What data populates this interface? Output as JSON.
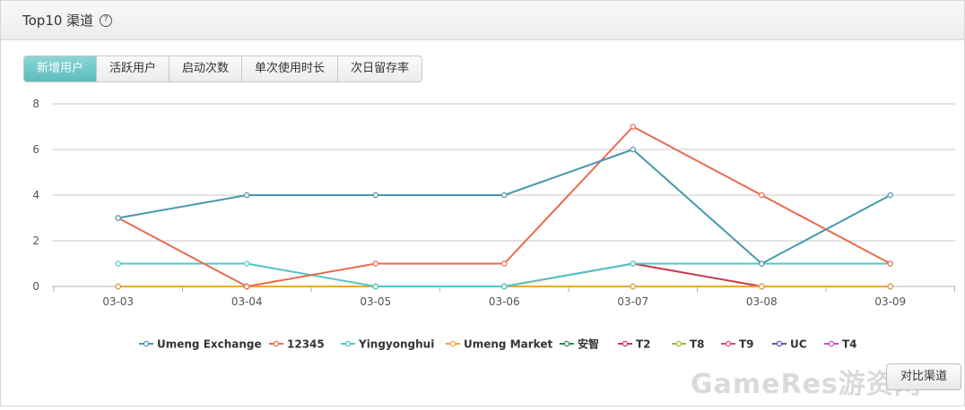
{
  "header": {
    "title": "Top10 渠道",
    "help_icon": "?"
  },
  "tabs": [
    {
      "label": "新增用户",
      "active": true
    },
    {
      "label": "活跃用户",
      "active": false
    },
    {
      "label": "启动次数",
      "active": false
    },
    {
      "label": "单次使用时长",
      "active": false
    },
    {
      "label": "次日留存率",
      "active": false
    }
  ],
  "compare_button": "对比渠道",
  "watermark": "GameRes游资网",
  "chart_data": {
    "type": "line",
    "categories": [
      "03-03",
      "03-04",
      "03-05",
      "03-06",
      "03-07",
      "03-08",
      "03-09"
    ],
    "ylim": [
      0,
      8
    ],
    "yticks": [
      0,
      2,
      4,
      6,
      8
    ],
    "grid": true,
    "legend_position": "bottom",
    "series": [
      {
        "name": "Umeng Exchange",
        "color": "#4899ab",
        "values": [
          3,
          4,
          4,
          4,
          6,
          1,
          4
        ]
      },
      {
        "name": "12345",
        "color": "#ea6b4b",
        "values": [
          3,
          0,
          1,
          1,
          7,
          4,
          1
        ]
      },
      {
        "name": "Yingyonghui",
        "color": "#50c6c6",
        "values": [
          1,
          1,
          0,
          0,
          1,
          1,
          1
        ]
      },
      {
        "name": "Umeng Market",
        "color": "#f0a33b",
        "values": [
          0,
          0,
          0,
          0,
          0,
          0,
          0
        ]
      },
      {
        "name": "安智",
        "color": "#2e8b57",
        "values": [
          0,
          0,
          0,
          0,
          0,
          0,
          0
        ]
      },
      {
        "name": "T2",
        "color": "#c8374f",
        "values": [
          0,
          0,
          0,
          0,
          1,
          0,
          0
        ]
      },
      {
        "name": "T8",
        "color": "#9bbb3a",
        "values": [
          0,
          0,
          0,
          0,
          0,
          0,
          0
        ]
      },
      {
        "name": "T9",
        "color": "#e0457b",
        "values": [
          0,
          0,
          0,
          0,
          0,
          0,
          0
        ]
      },
      {
        "name": "UC",
        "color": "#6a4fa0",
        "values": [
          0,
          0,
          0,
          0,
          0,
          0,
          0
        ]
      },
      {
        "name": "T4",
        "color": "#c44fc0",
        "values": [
          0,
          0,
          0,
          0,
          0,
          0,
          0
        ]
      }
    ]
  }
}
